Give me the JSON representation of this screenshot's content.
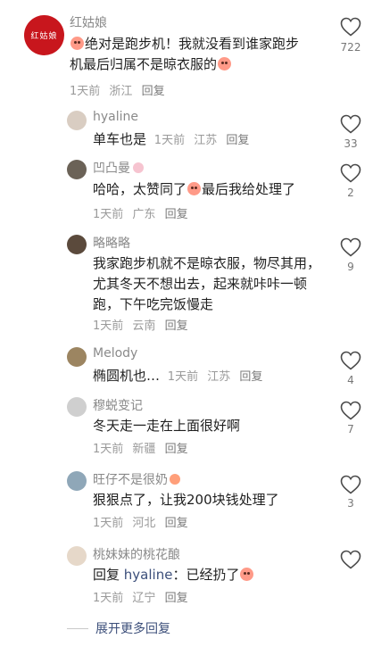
{
  "comments": [
    {
      "username": "红姑娘",
      "avatar_text": "红姑娘",
      "text_a": "绝对是跑步机！我就没看到谁家跑步",
      "text_b": "机最后归属不是晾衣服的",
      "time": "1天前",
      "location": "浙江",
      "reply_label": "回复",
      "likes": "722"
    }
  ],
  "replies": [
    {
      "username": "hyaline",
      "text": "单车也是",
      "time": "1天前",
      "location": "江苏",
      "reply_label": "回复",
      "likes": "33"
    },
    {
      "username": "凹凸曼",
      "text_a": "哈哈，太赞同了",
      "text_b": "最后我给处理了",
      "time": "1天前",
      "location": "广东",
      "reply_label": "回复",
      "likes": "2"
    },
    {
      "username": "略略略",
      "line1": "我家跑步机就不是晾衣服，物尽其用，",
      "line2": "尤其冬天不想出去，起来就咔咔一顿",
      "line3": "跑，下午吃完饭慢走",
      "time": "1天前",
      "location": "云南",
      "reply_label": "回复",
      "likes": "9"
    },
    {
      "username": "Melody",
      "text": "椭圆机也…",
      "time": "1天前",
      "location": "江苏",
      "reply_label": "回复",
      "likes": "4"
    },
    {
      "username": "穆蜕变记",
      "text": "冬天走一走在上面很好啊",
      "time": "1天前",
      "location": "新疆",
      "reply_label": "回复",
      "likes": "7"
    },
    {
      "username": "旺仔不是很奶",
      "text": "狠狠点了，让我200块钱处理了",
      "time": "1天前",
      "location": "河北",
      "reply_label": "回复",
      "likes": "3"
    },
    {
      "username": "桃妹妹的桃花酿",
      "text_a": "回复 ",
      "mention": "hyaline",
      "text_b": "：已经扔了",
      "time": "1天前",
      "location": "辽宁",
      "reply_label": "回复",
      "likes": ""
    }
  ],
  "expand_label": "展开更多回复",
  "icons": {
    "like": "heart-outline-icon",
    "emoji": "sticker-emoji-icon"
  },
  "colors": {
    "avatar_main": "#c8161d",
    "link": "#3c4f7a",
    "meta": "#9a9a9a"
  }
}
